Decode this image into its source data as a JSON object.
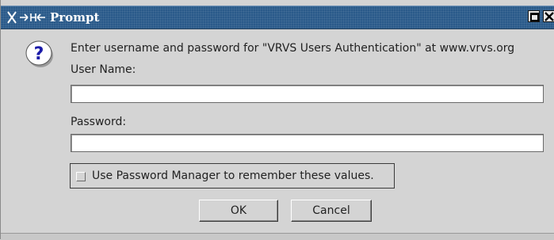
{
  "window": {
    "title": "Prompt"
  },
  "titlebar": {
    "icons": [
      "window-menu-icon",
      "maximize-icon",
      "close-icon"
    ]
  },
  "dialog": {
    "icon": "question-icon",
    "message": "Enter username and password for \"VRVS Users Authentication\" at www.vrvs.org",
    "username_label": "User Name:",
    "username_value": "",
    "password_label": "Password:",
    "password_value": "",
    "remember_label": "Use Password Manager to remember these values.",
    "remember_checked": false,
    "ok_label": "OK",
    "cancel_label": "Cancel"
  },
  "colors": {
    "titlebar": "#2a5a8a",
    "dialog_bg": "#d4d4d4",
    "question_icon": "#1a1aa8"
  }
}
